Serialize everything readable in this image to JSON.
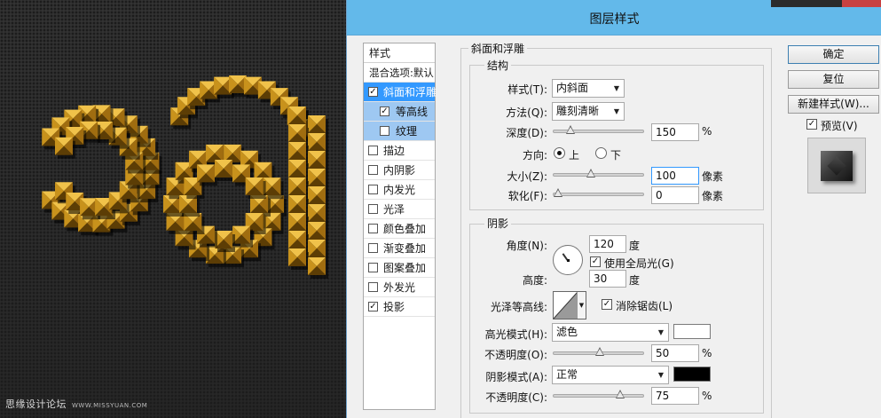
{
  "dialog": {
    "title": "图层样式",
    "buttons": {
      "ok": "确定",
      "reset": "复位",
      "new_style": "新建样式(W)..."
    },
    "preview": {
      "label": "预览(V)",
      "checked": true
    }
  },
  "style_list": {
    "header": "样式",
    "blend_options": "混合选项:默认",
    "items": [
      {
        "label": "斜面和浮雕",
        "checked": true,
        "state": "selected"
      },
      {
        "label": "等高线",
        "checked": true,
        "state": "sub-active",
        "sub": true
      },
      {
        "label": "纹理",
        "checked": false,
        "state": "sub",
        "sub": true
      },
      {
        "label": "描边",
        "checked": false
      },
      {
        "label": "内阴影",
        "checked": false
      },
      {
        "label": "内发光",
        "checked": false
      },
      {
        "label": "光泽",
        "checked": false
      },
      {
        "label": "颜色叠加",
        "checked": false
      },
      {
        "label": "渐变叠加",
        "checked": false
      },
      {
        "label": "图案叠加",
        "checked": false
      },
      {
        "label": "外发光",
        "checked": false
      },
      {
        "label": "投影",
        "checked": true
      }
    ]
  },
  "bevel": {
    "section_title": "斜面和浮雕",
    "structure": {
      "title": "结构",
      "style_label": "样式(T):",
      "style_value": "内斜面",
      "technique_label": "方法(Q):",
      "technique_value": "雕刻清晰",
      "depth_label": "深度(D):",
      "depth_value": "150",
      "depth_unit": "%",
      "depth_fraction": 0.15,
      "direction_label": "方向:",
      "direction_up": "上",
      "direction_down": "下",
      "direction_selected": "上",
      "size_label": "大小(Z):",
      "size_value": "100",
      "size_unit": "像素",
      "size_fraction": 0.4,
      "soften_label": "软化(F):",
      "soften_value": "0",
      "soften_unit": "像素",
      "soften_fraction": 0.0
    },
    "shading": {
      "title": "阴影",
      "angle_label": "角度(N):",
      "angle_value": "120",
      "angle_unit": "度",
      "global_light_label": "使用全局光(G)",
      "global_light_checked": true,
      "altitude_label": "高度:",
      "altitude_value": "30",
      "altitude_unit": "度",
      "gloss_contour_label": "光泽等高线:",
      "anti_alias_label": "消除锯齿(L)",
      "anti_alias_checked": true,
      "highlight_mode_label": "高光模式(H):",
      "highlight_mode_value": "滤色",
      "highlight_color": "#ffffff",
      "highlight_opacity_label": "不透明度(O):",
      "highlight_opacity_value": "50",
      "highlight_opacity_unit": "%",
      "highlight_opacity_fraction": 0.5,
      "shadow_mode_label": "阴影模式(A):",
      "shadow_mode_value": "正常",
      "shadow_color": "#000000",
      "shadow_opacity_label": "不透明度(C):",
      "shadow_opacity_value": "75",
      "shadow_opacity_unit": "%",
      "shadow_opacity_fraction": 0.75
    }
  },
  "canvas": {
    "watermark": "思缘设计论坛",
    "watermark_url": "WWW.MISSYUAN.COM",
    "stud_color": "#c8921c"
  },
  "colors": {
    "titlebar": "#63b9ea",
    "selection": "#3399ff",
    "sub_selection": "#9ec8f2"
  }
}
